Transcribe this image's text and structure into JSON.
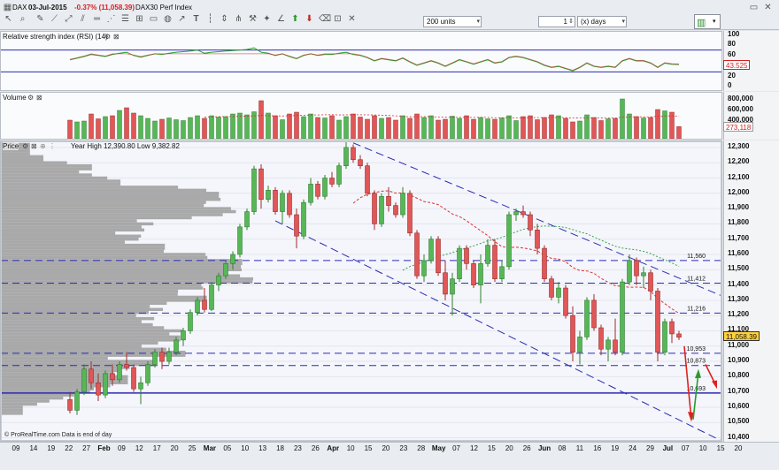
{
  "header": {
    "symbol": "DAX",
    "date": "03-Jul-2015",
    "change": "-0.37% (11,058.39)",
    "index_name": "DAX30 Perf Index",
    "units": "200 units",
    "period_value": "1",
    "period_unit": "(x) days"
  },
  "rsi": {
    "title": "Relative strength index (RSI) (14)",
    "ticks": [
      "100",
      "80",
      "60",
      "40",
      "20",
      "0"
    ],
    "value": "43.525"
  },
  "volume": {
    "title": "Volume",
    "ticks": [
      "800,000",
      "600,000",
      "400,000"
    ],
    "value": "273,118"
  },
  "price": {
    "title": "Price",
    "yearline": "Year High 12,390.80 Low 9,382.82",
    "ticks": [
      "12,300",
      "12,200",
      "12,100",
      "12,000",
      "11,900",
      "11,800",
      "11,700",
      "11,600",
      "11,500",
      "11,400",
      "11,300",
      "11,200",
      "11,100",
      "11,000",
      "10,900",
      "10,800",
      "10,700",
      "10,600",
      "10,500",
      "10,400"
    ],
    "levels": [
      {
        "label": "11,560",
        "value": 11560
      },
      {
        "label": "11,412",
        "value": 11412
      },
      {
        "label": "11,216",
        "value": 11216
      },
      {
        "label": "10,953",
        "value": 10953
      },
      {
        "label": "10,873",
        "value": 10873
      },
      {
        "label": "10,693",
        "value": 10693
      }
    ],
    "last": "11,058.39",
    "footer": "© ProRealTime.com  Data is end of day"
  },
  "xaxis": [
    {
      "t": "09",
      "b": false
    },
    {
      "t": "14",
      "b": false
    },
    {
      "t": "19",
      "b": false
    },
    {
      "t": "22",
      "b": false
    },
    {
      "t": "27",
      "b": false
    },
    {
      "t": "Feb",
      "b": true
    },
    {
      "t": "09",
      "b": false
    },
    {
      "t": "12",
      "b": false
    },
    {
      "t": "17",
      "b": false
    },
    {
      "t": "20",
      "b": false
    },
    {
      "t": "25",
      "b": false
    },
    {
      "t": "Mar",
      "b": true
    },
    {
      "t": "05",
      "b": false
    },
    {
      "t": "10",
      "b": false
    },
    {
      "t": "13",
      "b": false
    },
    {
      "t": "18",
      "b": false
    },
    {
      "t": "23",
      "b": false
    },
    {
      "t": "26",
      "b": false
    },
    {
      "t": "Apr",
      "b": true
    },
    {
      "t": "10",
      "b": false
    },
    {
      "t": "15",
      "b": false
    },
    {
      "t": "20",
      "b": false
    },
    {
      "t": "23",
      "b": false
    },
    {
      "t": "28",
      "b": false
    },
    {
      "t": "May",
      "b": true
    },
    {
      "t": "07",
      "b": false
    },
    {
      "t": "12",
      "b": false
    },
    {
      "t": "15",
      "b": false
    },
    {
      "t": "20",
      "b": false
    },
    {
      "t": "26",
      "b": false
    },
    {
      "t": "Jun",
      "b": true
    },
    {
      "t": "08",
      "b": false
    },
    {
      "t": "11",
      "b": false
    },
    {
      "t": "16",
      "b": false
    },
    {
      "t": "19",
      "b": false
    },
    {
      "t": "24",
      "b": false
    },
    {
      "t": "29",
      "b": false
    },
    {
      "t": "Jul",
      "b": true
    },
    {
      "t": "07",
      "b": false
    },
    {
      "t": "10",
      "b": false
    },
    {
      "t": "15",
      "b": false
    },
    {
      "t": "20",
      "b": false
    }
  ],
  "chart_data": {
    "type": "candlestick",
    "note": "DAX daily OHLC, early Jan to 03-Jul-2015",
    "ohlc": [
      [
        10650,
        10700,
        10560,
        10580
      ],
      [
        10580,
        10720,
        10550,
        10700
      ],
      [
        10700,
        10880,
        10680,
        10850
      ],
      [
        10850,
        10900,
        10720,
        10760
      ],
      [
        10760,
        10820,
        10640,
        10680
      ],
      [
        10680,
        10840,
        10660,
        10820
      ],
      [
        10820,
        10880,
        10740,
        10780
      ],
      [
        10780,
        10900,
        10760,
        10880
      ],
      [
        10880,
        10960,
        10840,
        10860
      ],
      [
        10860,
        10880,
        10700,
        10720
      ],
      [
        10720,
        10800,
        10620,
        10760
      ],
      [
        10760,
        10900,
        10740,
        10880
      ],
      [
        10880,
        10980,
        10860,
        10960
      ],
      [
        10960,
        10990,
        10850,
        10900
      ],
      [
        10900,
        10990,
        10880,
        10960
      ],
      [
        10960,
        11060,
        10940,
        11040
      ],
      [
        11040,
        11120,
        11000,
        11100
      ],
      [
        11100,
        11240,
        11080,
        11220
      ],
      [
        11220,
        11320,
        11200,
        11300
      ],
      [
        11300,
        11380,
        11220,
        11240
      ],
      [
        11240,
        11420,
        11230,
        11400
      ],
      [
        11400,
        11480,
        11360,
        11460
      ],
      [
        11460,
        11560,
        11440,
        11540
      ],
      [
        11540,
        11620,
        11500,
        11600
      ],
      [
        11600,
        11800,
        11580,
        11780
      ],
      [
        11780,
        11900,
        11760,
        11880
      ],
      [
        11880,
        12180,
        11860,
        12160
      ],
      [
        12160,
        12190,
        11900,
        11960
      ],
      [
        11960,
        12050,
        11940,
        12020
      ],
      [
        12020,
        12040,
        11860,
        11880
      ],
      [
        11880,
        12020,
        11800,
        12000
      ],
      [
        12000,
        12020,
        11840,
        11860
      ],
      [
        11860,
        11900,
        11640,
        11720
      ],
      [
        11720,
        11960,
        11700,
        11940
      ],
      [
        11940,
        12100,
        11920,
        12060
      ],
      [
        12060,
        12080,
        11960,
        11980
      ],
      [
        11980,
        12120,
        11960,
        12100
      ],
      [
        12100,
        12140,
        12040,
        12060
      ],
      [
        12060,
        12200,
        12040,
        12180
      ],
      [
        12180,
        12390,
        12160,
        12300
      ],
      [
        12300,
        12320,
        12200,
        12220
      ],
      [
        12220,
        12250,
        12160,
        12180
      ],
      [
        12180,
        12200,
        11980,
        12000
      ],
      [
        12000,
        12020,
        11760,
        11800
      ],
      [
        11800,
        12000,
        11780,
        11980
      ],
      [
        11980,
        12040,
        11880,
        11920
      ],
      [
        11920,
        11940,
        11840,
        11860
      ],
      [
        11860,
        12040,
        11840,
        12000
      ],
      [
        12000,
        12020,
        11720,
        11740
      ],
      [
        11740,
        11760,
        11440,
        11460
      ],
      [
        11460,
        11600,
        11420,
        11560
      ],
      [
        11560,
        11720,
        11540,
        11700
      ],
      [
        11700,
        11720,
        11460,
        11480
      ],
      [
        11480,
        11560,
        11300,
        11340
      ],
      [
        11340,
        11480,
        11200,
        11440
      ],
      [
        11440,
        11660,
        11420,
        11640
      ],
      [
        11640,
        11660,
        11500,
        11540
      ],
      [
        11540,
        11560,
        11380,
        11400
      ],
      [
        11400,
        11600,
        11280,
        11540
      ],
      [
        11540,
        11700,
        11520,
        11660
      ],
      [
        11660,
        11700,
        11420,
        11440
      ],
      [
        11440,
        11560,
        11420,
        11520
      ],
      [
        11520,
        11880,
        11500,
        11860
      ],
      [
        11860,
        11900,
        11820,
        11880
      ],
      [
        11880,
        11920,
        11840,
        11860
      ],
      [
        11860,
        11880,
        11720,
        11760
      ],
      [
        11760,
        11800,
        11600,
        11640
      ],
      [
        11640,
        11660,
        11420,
        11440
      ],
      [
        11440,
        11460,
        11300,
        11320
      ],
      [
        11320,
        11420,
        11280,
        11380
      ],
      [
        11380,
        11400,
        11180,
        11200
      ],
      [
        11200,
        11260,
        10900,
        10960
      ],
      [
        10960,
        11100,
        10880,
        11060
      ],
      [
        11060,
        11320,
        11040,
        11300
      ],
      [
        11300,
        11340,
        11100,
        11120
      ],
      [
        11120,
        11140,
        10940,
        10980
      ],
      [
        10980,
        11060,
        10900,
        11040
      ],
      [
        11040,
        11180,
        10940,
        10960
      ],
      [
        10960,
        11440,
        10940,
        11420
      ],
      [
        11420,
        11600,
        11400,
        11560
      ],
      [
        11560,
        11580,
        11400,
        11460
      ],
      [
        11460,
        11520,
        11380,
        11480
      ],
      [
        11480,
        11500,
        11300,
        11360
      ],
      [
        11360,
        11380,
        10900,
        10960
      ],
      [
        10960,
        11180,
        10940,
        11160
      ],
      [
        11160,
        11180,
        11020,
        11080
      ],
      [
        11080,
        11100,
        11040,
        11058
      ]
    ],
    "volume": [
      420,
      380,
      400,
      560,
      450,
      500,
      520,
      640,
      700,
      580,
      520,
      460,
      400,
      440,
      470,
      430,
      410,
      480,
      520,
      460,
      520,
      490,
      500,
      560,
      580,
      540,
      610,
      860,
      580,
      520,
      430,
      560,
      600,
      500,
      560,
      480,
      470,
      520,
      420,
      500,
      560,
      490,
      440,
      520,
      460,
      480,
      420,
      520,
      460,
      560,
      480,
      520,
      420,
      440,
      510,
      460,
      520,
      440,
      480,
      450,
      440,
      470,
      520,
      410,
      500,
      520,
      430,
      480,
      540,
      520,
      460,
      380,
      400,
      540,
      480,
      410,
      450,
      460,
      900,
      560,
      500,
      470,
      480,
      660,
      630,
      600,
      273
    ],
    "rsi": [
      52,
      55,
      58,
      62,
      60,
      58,
      62,
      64,
      66,
      60,
      57,
      60,
      63,
      62,
      64,
      66,
      67,
      68,
      70,
      64,
      66,
      67,
      68,
      69,
      70,
      71,
      74,
      66,
      64,
      60,
      63,
      58,
      54,
      60,
      63,
      60,
      62,
      62,
      64,
      66,
      62,
      60,
      56,
      50,
      54,
      52,
      50,
      55,
      48,
      42,
      46,
      50,
      46,
      40,
      46,
      52,
      48,
      44,
      48,
      52,
      46,
      48,
      56,
      58,
      56,
      52,
      48,
      42,
      38,
      40,
      36,
      32,
      38,
      46,
      40,
      38,
      40,
      38,
      50,
      54,
      50,
      50,
      46,
      38,
      46,
      44,
      43.5
    ],
    "ylim": [
      10380,
      12340
    ],
    "xlim_days": [
      0,
      183
    ]
  }
}
